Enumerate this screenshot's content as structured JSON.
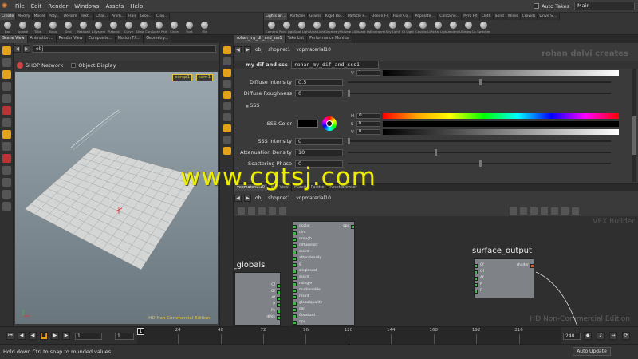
{
  "menubar": {
    "items": [
      "File",
      "Edit",
      "Render",
      "Windows",
      "Assets",
      "Help"
    ],
    "auto_takes": "Auto Takes",
    "desktop": "Main"
  },
  "shelf_left": {
    "tabs": [
      "Create",
      "Modify",
      "Model",
      "Poly...",
      "Deform",
      "Text...",
      "Char...",
      "Anim...",
      "Hair",
      "Groo...",
      "Clou..."
    ],
    "tools": [
      "Box",
      "Sphere",
      "Tube",
      "Torus",
      "Grid",
      "Metaball",
      "L-System",
      "Platonic",
      "Curve",
      "Draw Curve",
      "Spray Paint",
      "Circle",
      "Font",
      "File"
    ]
  },
  "shelf_right": {
    "tabs": [
      "Lights an...",
      "Particles",
      "Grains",
      "Rigid Bo...",
      "Particle F...",
      "Ocean FX",
      "Fluid Co...",
      "Populate ...",
      "Containe...",
      "Pyro FX",
      "Cloth",
      "Solid",
      "Wires",
      "Crowds",
      "Drive Si..."
    ],
    "tools": [
      "Camera",
      "Point Light",
      "Spot Light",
      "Area Light",
      "Geometry",
      "Volume Light",
      "Distant Light",
      "Environme...",
      "Sky Light",
      "GI Light",
      "Caustic Light",
      "Portal Light",
      "Ambient Li...",
      "Stereo Ca...",
      "Switcher"
    ]
  },
  "left_panetabs": [
    "Scene View",
    "Animation...",
    "Render View",
    "Composite...",
    "Motion FX...",
    "Geometry..."
  ],
  "right_panetabs": [
    "rohan_my_dif_and_sss1",
    "Take List",
    "Performance Monitor"
  ],
  "viewport": {
    "path": "obj",
    "network_type": "SHOP Network",
    "display_label": "Object Display",
    "camera": "persp1",
    "cam_option": "cam1",
    "license": "HD Non-Commercial Edition"
  },
  "param": {
    "path": [
      "obj",
      "shopnet1",
      "vopmaterial10"
    ],
    "node_type": "my dif and sss",
    "node_name": "rohan_my_dif_and_sss1",
    "watermark": "rohan dalvi creates",
    "rows": [
      {
        "label": "Diffuse intensity",
        "value": "0.5",
        "slider": 0.5
      },
      {
        "label": "Diffuse Roughness",
        "value": "0",
        "slider": 0
      }
    ],
    "section": "SSS",
    "sss_color_label": "SSS Color",
    "top_v": "1",
    "sss_channels": [
      {
        "ch": "H",
        "value": "0"
      },
      {
        "ch": "S",
        "value": "0"
      },
      {
        "ch": "V",
        "value": "0"
      }
    ],
    "sss_rows": [
      {
        "label": "SSS intensity",
        "value": "0",
        "slider": 0
      },
      {
        "label": "Attenuation Density",
        "value": "10",
        "slider": 0.33
      },
      {
        "label": "Scattering Phase",
        "value": "0",
        "slider": 0.5
      }
    ],
    "colors": {
      "hue_bar": "rainbow",
      "sat_bar": "#000000",
      "val_bar": "#ffffff",
      "swatch": "#000000"
    }
  },
  "network": {
    "tabs": [
      "vopmaterial10",
      "Tree View",
      "Material Palette",
      "Asset Browser"
    ],
    "path": [
      "obj",
      "shopnet1",
      "vopmaterial10"
    ],
    "label_top": "VEX Builder",
    "license": "HD Non-Commercial Edition",
    "globals_title": "ce_globals",
    "globals_ports": [
      "Cf",
      "Of",
      "Af",
      "P",
      "Ps",
      "dPds"
    ],
    "params_ports": [
      "dcolor",
      "dint",
      "drough",
      "diffusecolr",
      "sssint",
      "attendensity",
      "g",
      "singlescat",
      "sssint",
      "nsingle",
      "multienable",
      "msint",
      "globalquality",
      "con",
      "Constant",
      "opc"
    ],
    "params_out": "_opc",
    "output_title": "surface_output",
    "output_ports": [
      "Cf",
      "Of",
      "Af",
      "N",
      "F"
    ],
    "output_out": "shader"
  },
  "timeline": {
    "start": "1",
    "end_field": "1",
    "current": "1",
    "ticks": [
      "24",
      "48",
      "72",
      "96",
      "120",
      "144",
      "168",
      "192",
      "216"
    ],
    "end": "240"
  },
  "status": {
    "message": "Hold down Ctrl to snap to rounded values",
    "auto_update": "Auto Update"
  },
  "watermark": "www.cgtsj.com"
}
